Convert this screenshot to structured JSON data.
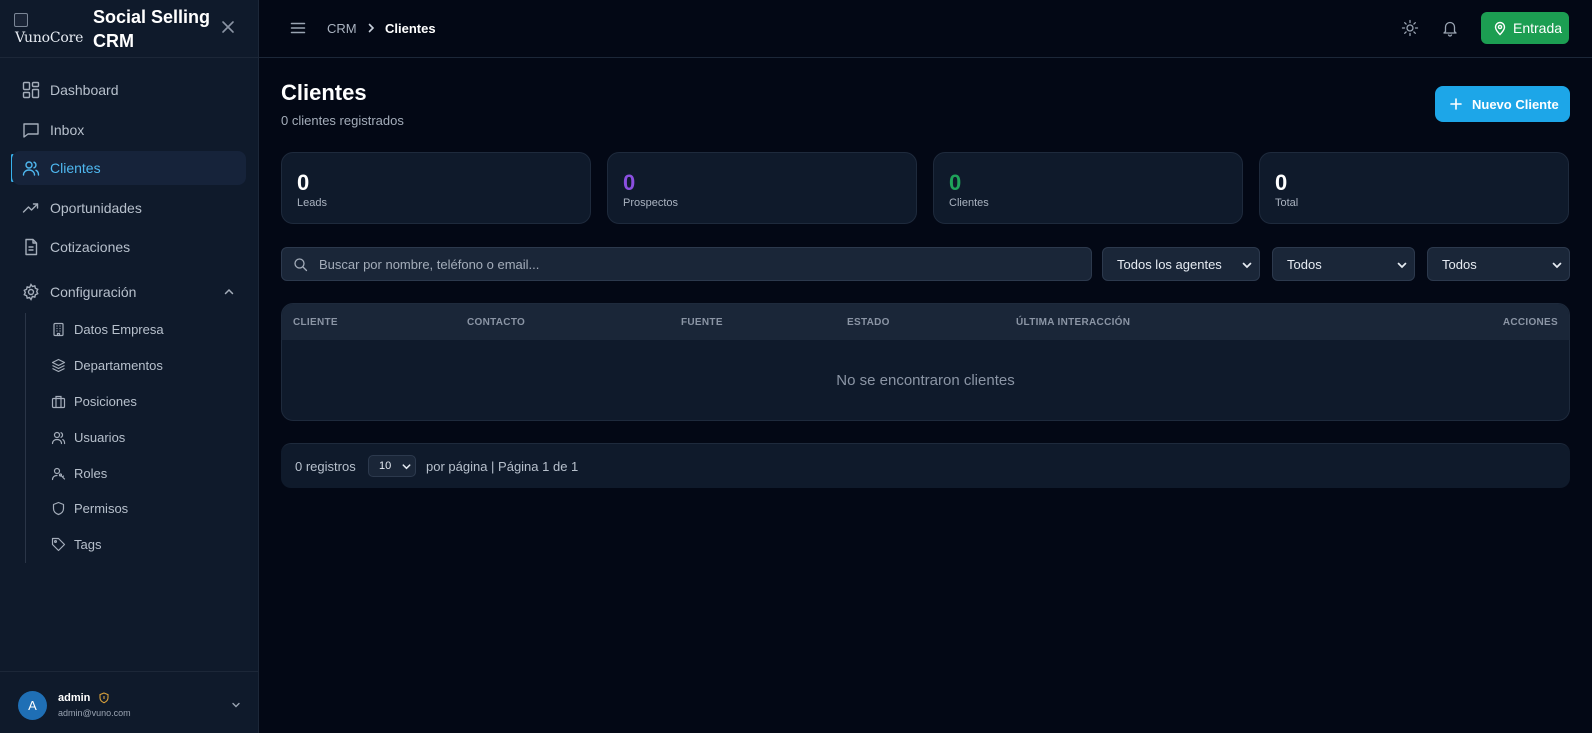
{
  "brand": {
    "logo_alt": "VunoCore",
    "title": "Social Selling CRM"
  },
  "sidebar": {
    "items": [
      {
        "label": "Dashboard",
        "icon": "dashboard-icon"
      },
      {
        "label": "Inbox",
        "icon": "inbox-icon"
      },
      {
        "label": "Clientes",
        "icon": "users-icon",
        "active": true
      },
      {
        "label": "Oportunidades",
        "icon": "trending-icon"
      },
      {
        "label": "Cotizaciones",
        "icon": "document-icon"
      },
      {
        "label": "Configuración",
        "icon": "gear-icon",
        "expanded": true
      }
    ],
    "config_items": [
      {
        "label": "Datos Empresa",
        "icon": "building-icon"
      },
      {
        "label": "Departamentos",
        "icon": "layers-icon"
      },
      {
        "label": "Posiciones",
        "icon": "briefcase-icon"
      },
      {
        "label": "Usuarios",
        "icon": "users-icon"
      },
      {
        "label": "Roles",
        "icon": "user-key-icon"
      },
      {
        "label": "Permisos",
        "icon": "shield-icon"
      },
      {
        "label": "Tags",
        "icon": "tag-icon"
      }
    ],
    "user": {
      "initial": "A",
      "name": "admin",
      "email": "admin@vuno.com"
    }
  },
  "topbar": {
    "breadcrumb": [
      "CRM",
      "Clientes"
    ],
    "entrada_label": "Entrada"
  },
  "page": {
    "title": "Clientes",
    "subtitle": "0 clientes registrados",
    "new_button": "Nuevo Cliente"
  },
  "stats": [
    {
      "value": "0",
      "label": "Leads",
      "color": "#ffffff"
    },
    {
      "value": "0",
      "label": "Prospectos",
      "color": "#8b4fe0"
    },
    {
      "value": "0",
      "label": "Clientes",
      "color": "#1fa35a"
    },
    {
      "value": "0",
      "label": "Total",
      "color": "#ffffff"
    }
  ],
  "filters": {
    "search_placeholder": "Buscar por nombre, teléfono o email...",
    "agent": "Todos los agentes",
    "filter2": "Todos",
    "filter3": "Todos"
  },
  "table": {
    "columns": [
      "CLIENTE",
      "CONTACTO",
      "FUENTE",
      "ESTADO",
      "ÚLTIMA INTERACCIÓN",
      "ACCIONES"
    ],
    "empty_message": "No se encontraron clientes"
  },
  "pagination": {
    "records": "0 registros",
    "per_page": "10",
    "summary": "por página | Página 1 de 1"
  },
  "colors": {
    "accent": "#1da6e8",
    "success": "#1c9e52",
    "background": "#030815",
    "panel": "#0f1a2b"
  }
}
